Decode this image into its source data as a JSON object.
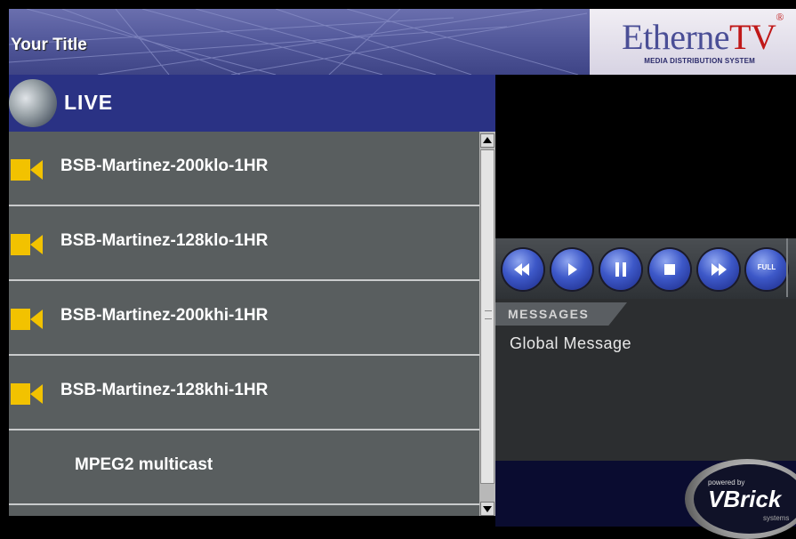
{
  "header": {
    "title": "Your Title",
    "logo_main": "Etherne",
    "logo_accent": "TV",
    "logo_mark": "®",
    "logo_subtitle": "MEDIA DISTRIBUTION SYSTEM"
  },
  "live": {
    "label": "LIVE",
    "icon": "live-disc-icon"
  },
  "streams": [
    {
      "label": "BSB-Martinez-200klo-1HR",
      "icon": "video-camera-icon"
    },
    {
      "label": "BSB-Martinez-128klo-1HR",
      "icon": "video-camera-icon"
    },
    {
      "label": "BSB-Martinez-200khi-1HR",
      "icon": "video-camera-icon"
    },
    {
      "label": "BSB-Martinez-128khi-1HR",
      "icon": "video-camera-icon"
    },
    {
      "label": "MPEG2 multicast",
      "icon": ""
    }
  ],
  "controls": {
    "rewind": "rewind-icon",
    "play": "play-icon",
    "pause": "pause-icon",
    "stop": "stop-icon",
    "fast_forward": "fast-forward-icon",
    "full_label": "FULL"
  },
  "messages": {
    "tab_label": "MESSAGES",
    "text": "Global Message"
  },
  "branding": {
    "powered_by": "powered by",
    "name": "VBrick",
    "suffix": "systems"
  },
  "colors": {
    "accent": "#2a3284",
    "list_bg": "#595e5f",
    "camera_icon": "#f2c200",
    "button_blue": "#3d58c8"
  }
}
